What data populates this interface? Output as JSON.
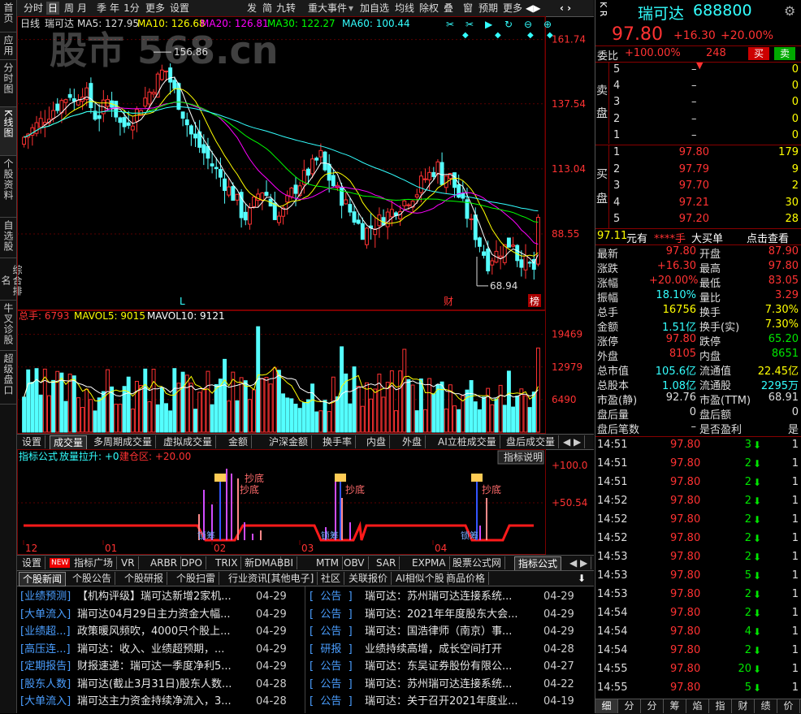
{
  "left_nav": [
    {
      "label": "首页"
    },
    {
      "label": "应用"
    },
    {
      "label": "分时图"
    },
    {
      "label": "K线图"
    },
    {
      "label": "个股资料"
    },
    {
      "label": "自选股"
    },
    {
      "label": "综合排名"
    },
    {
      "label": "牛叉诊股"
    },
    {
      "label": "超级盘口"
    }
  ],
  "toolbar": {
    "items": [
      "分时",
      "日",
      "周",
      "月",
      "季",
      "年",
      "1分",
      "更多",
      "设置"
    ],
    "right_items": [
      "发",
      "简",
      "九转",
      "重大事件",
      "加自选",
      "均线",
      "除权",
      "叠",
      "窗",
      "预期",
      "更多"
    ]
  },
  "watermark": "股市 568.cn",
  "kline": {
    "header_period": "日线",
    "header_name": "瑞可达",
    "ma5": "MA5: 127.95",
    "ma10": "MA10: 126.68",
    "ma20": "MA20: 126.81",
    "ma30": "MA30: 122.27",
    "ma60": "MA60: 100.44",
    "y_ticks": [
      "161.74",
      "137.54",
      "113.04",
      "88.55"
    ],
    "high_label": "156.86",
    "low_label": "68.94",
    "marker_L": "L",
    "marker_cai": "财",
    "marker_bang": "榜"
  },
  "volume": {
    "total": "总手: 6793",
    "mavol5": "MAVOL5: 9015",
    "mavol10": "MAVOL10: 9121",
    "y_ticks": [
      "19469",
      "12979",
      "6490"
    ]
  },
  "mid_tabs": [
    "设置",
    "成交量",
    "多周期成交量",
    "虚拟成交量",
    "金额",
    "沪深金额",
    "换手率",
    "内盘",
    "外盘",
    "AI立桩成交量",
    "盘后成交量"
  ],
  "indicator": {
    "title": "指标公式",
    "pull": "放量拉升: +0",
    "build": "建仓区: +20.00",
    "explain": "指标说明",
    "y_top": "+100.0",
    "y_mid": "+50.54",
    "x_ticks": [
      "12",
      "01",
      "02",
      "03",
      "04"
    ],
    "chaodi": "抄底",
    "xidi": "锁筹"
  },
  "bottom_tabs": [
    "设置",
    "指标广场",
    "VR",
    "ARBR",
    "DPO",
    "TRIX",
    "新DMA",
    "BBI",
    "MTM",
    "OBV",
    "SAR",
    "EXPMA",
    "股票公式网",
    "指标公式"
  ],
  "new_badge": "NEW",
  "news_tabs": [
    "个股新闻",
    "个股公告",
    "个股研报",
    "个股扫雷",
    "行业资讯[其他电子]",
    "社区",
    "关联报价",
    "AI相似个股",
    "商品价格"
  ],
  "news_left": [
    {
      "tag": "[业绩预测]",
      "text": "【机构评级】瑞可达新增2家机...",
      "date": "04-29"
    },
    {
      "tag": "[大单流入]",
      "text": "瑞可达04月29日主力资金大幅...",
      "date": "04-29"
    },
    {
      "tag": "[业绩超...]",
      "text": "政策暖风频吹，4000只个股上...",
      "date": "04-29"
    },
    {
      "tag": "[高压连...]",
      "text": "瑞可达：收入、业绩超预期，...",
      "date": "04-29"
    },
    {
      "tag": "[定期报告]",
      "text": "财报速递：瑞可达一季度净利5...",
      "date": "04-29"
    },
    {
      "tag": "[股东人数]",
      "text": "瑞可达(截止3月31日)股东人数...",
      "date": "04-28"
    },
    {
      "tag": "[大单流入]",
      "text": "瑞可达主力资金持续净流入，3...",
      "date": "04-28"
    }
  ],
  "news_right": [
    {
      "tag": "[  公告  ]",
      "text": "瑞可达：苏州瑞可达连接系统...",
      "date": "04-29"
    },
    {
      "tag": "[  公告  ]",
      "text": "瑞可达：2021年年度股东大会...",
      "date": "04-29"
    },
    {
      "tag": "[  公告  ]",
      "text": "瑞可达：国浩律师（南京）事...",
      "date": "04-29"
    },
    {
      "tag": "[  研报  ]",
      "text": "业绩持续高增，成长空间打开",
      "date": "04-28"
    },
    {
      "tag": "[  公告  ]",
      "text": "瑞可达：东吴证券股份有限公...",
      "date": "04-27"
    },
    {
      "tag": "[  公告  ]",
      "text": "瑞可达：苏州瑞可达连接系统...",
      "date": "04-22"
    },
    {
      "tag": "[  公告  ]",
      "text": "瑞可达：关于召开2021年度业...",
      "date": "04-19"
    }
  ],
  "quote": {
    "kr": "K R",
    "name": "瑞可达",
    "code": "688800",
    "price": "97.80",
    "change": "+16.30",
    "pct": "+20.00%",
    "weibi_label": "委比",
    "weibi": "+100.00%",
    "weicha": "248",
    "buy_btn": "买",
    "sell_btn": "卖",
    "sell_label": "卖\n\n盘",
    "buy_label": "买\n\n盘",
    "asks": [
      {
        "lvl": "5",
        "price": "–",
        "vol": "0"
      },
      {
        "lvl": "4",
        "price": "–",
        "vol": "0"
      },
      {
        "lvl": "3",
        "price": "–",
        "vol": "0"
      },
      {
        "lvl": "2",
        "price": "–",
        "vol": "0"
      },
      {
        "lvl": "1",
        "price": "–",
        "vol": "0"
      }
    ],
    "bids": [
      {
        "lvl": "1",
        "price": "97.80",
        "vol": "179"
      },
      {
        "lvl": "2",
        "price": "97.79",
        "vol": "9"
      },
      {
        "lvl": "3",
        "price": "97.70",
        "vol": "2"
      },
      {
        "lvl": "4",
        "price": "97.21",
        "vol": "30"
      },
      {
        "lvl": "5",
        "price": "97.20",
        "vol": "28"
      }
    ],
    "bigorder_amt": "97.11",
    "bigorder_unit": "元有",
    "bigorder_hand": "****手",
    "bigorder_lbl": "大买单",
    "bigorder_link": "点击查看",
    "stats": [
      {
        "l": "最新",
        "v": "97.80",
        "l2": "开盘",
        "v2": "87.90"
      },
      {
        "l": "涨跌",
        "v": "+16.30",
        "l2": "最高",
        "v2": "97.80"
      },
      {
        "l": "涨幅",
        "v": "+20.00%",
        "l2": "最低",
        "v2": "83.05"
      },
      {
        "l": "振幅",
        "v": "18.10%",
        "l2": "量比",
        "v2": "3.29"
      },
      {
        "l": "总手",
        "v": "16756",
        "l2": "换手",
        "v2": "7.30%"
      },
      {
        "l": "金额",
        "v": "1.51亿",
        "l2": "换手(实)",
        "v2": "7.30%"
      },
      {
        "l": "涨停",
        "v": "97.80",
        "l2": "跌停",
        "v2": "65.20"
      },
      {
        "l": "外盘",
        "v": "8105",
        "l2": "内盘",
        "v2": "8651"
      },
      {
        "l": "总市值",
        "v": "105.6亿",
        "l2": "流通值",
        "v2": "22.45亿"
      },
      {
        "l": "总股本",
        "v": "1.08亿",
        "l2": "流通股",
        "v2": "2295万"
      },
      {
        "l": "市盈(静)",
        "v": "92.76",
        "l2": "市盈(TTM)",
        "v2": "68.91"
      },
      {
        "l": "盘后量",
        "v": "0",
        "l2": "盘后额",
        "v2": "0"
      },
      {
        "l": "盘后笔数",
        "v": "–",
        "l2": "是否盈利",
        "v2": "是"
      }
    ],
    "ticks": [
      {
        "t": "14:51",
        "p": "97.80",
        "v": "3",
        "n": "1"
      },
      {
        "t": "14:51",
        "p": "97.80",
        "v": "2",
        "n": "1"
      },
      {
        "t": "14:51",
        "p": "97.80",
        "v": "2",
        "n": "1"
      },
      {
        "t": "14:52",
        "p": "97.80",
        "v": "2",
        "n": "1"
      },
      {
        "t": "14:52",
        "p": "97.80",
        "v": "2",
        "n": "1"
      },
      {
        "t": "14:52",
        "p": "97.80",
        "v": "2",
        "n": "1"
      },
      {
        "t": "14:53",
        "p": "97.80",
        "v": "2",
        "n": "1"
      },
      {
        "t": "14:53",
        "p": "97.80",
        "v": "5",
        "n": "1"
      },
      {
        "t": "14:53",
        "p": "97.80",
        "v": "2",
        "n": "1"
      },
      {
        "t": "14:54",
        "p": "97.80",
        "v": "2",
        "n": "1"
      },
      {
        "t": "14:54",
        "p": "97.80",
        "v": "4",
        "n": "1"
      },
      {
        "t": "14:54",
        "p": "97.80",
        "v": "2",
        "n": "1"
      },
      {
        "t": "14:55",
        "p": "97.80",
        "v": "20",
        "n": "1"
      },
      {
        "t": "14:55",
        "p": "97.80",
        "v": "5",
        "n": "1"
      }
    ],
    "bottom_tabs": [
      "细",
      "分",
      "分",
      "筹",
      "焰",
      "指",
      "财",
      "绩",
      "价"
    ]
  },
  "colors": {
    "up": "#ff3232",
    "down": "#00e600",
    "cyan": "#54ffff",
    "yellow": "#ffff00"
  }
}
